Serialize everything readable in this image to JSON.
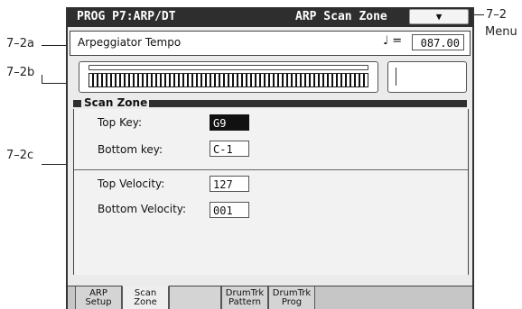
{
  "callouts": {
    "a": "7–2a",
    "b": "7–2b",
    "c": "7–2c",
    "menu_num": "7–2",
    "menu_word": "Menu"
  },
  "titlebar": {
    "left": "PROG P7:ARP/DT",
    "right": "ARP Scan Zone",
    "menu_glyph": "▼"
  },
  "tempo": {
    "label": "Arpeggiator Tempo",
    "note": "♩ =",
    "value": "087.00"
  },
  "scan_zone": {
    "title": "Scan Zone",
    "top_key": {
      "label": "Top Key:",
      "value": "G9"
    },
    "bottom_key": {
      "label": "Bottom key:",
      "value": "C-1"
    },
    "top_velocity": {
      "label": "Top Velocity:",
      "value": "127"
    },
    "bottom_velocity": {
      "label": "Bottom Velocity:",
      "value": "001"
    }
  },
  "tabs": [
    {
      "line1": "ARP",
      "line2": "Setup"
    },
    {
      "line1": "Scan",
      "line2": "Zone"
    },
    {
      "line1": "",
      "line2": ""
    },
    {
      "line1": "DrumTrk",
      "line2": "Pattern"
    },
    {
      "line1": "DrumTrk",
      "line2": "Prog"
    }
  ]
}
